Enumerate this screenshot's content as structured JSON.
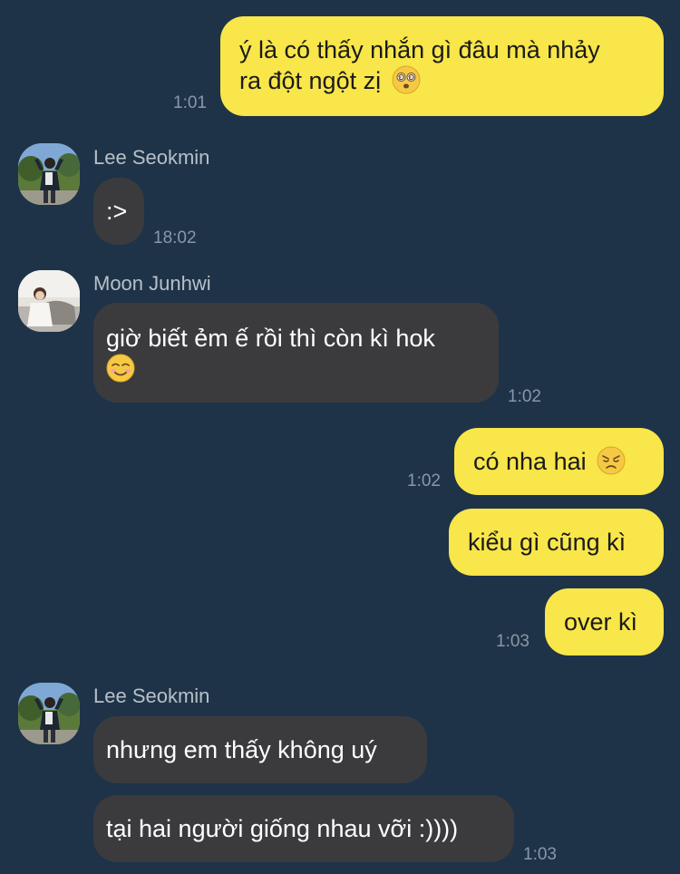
{
  "messages": {
    "m1": {
      "lines": [
        "ý là có thấy nhắn gì đâu mà nhảy",
        "ra đột ngột zị"
      ],
      "emoji": "dizzy-face-emoji",
      "time": "1:01"
    },
    "m2": {
      "sender": "Lee Seokmin",
      "text": ":>",
      "time": "18:02"
    },
    "m3": {
      "sender": "Moon Junhwi",
      "line1": "giờ biết ẻm ế rồi thì còn kì hok",
      "emoji": "smiling-face-emoji",
      "time": "1:02"
    },
    "m4": {
      "text": "có nha hai",
      "emoji": "disappointed-face-emoji",
      "time": "1:02"
    },
    "m5": {
      "text": "kiểu gì cũng kì"
    },
    "m6": {
      "text": "over kì",
      "time": "1:03"
    },
    "m7": {
      "sender": "Lee Seokmin",
      "text": "nhưng em thấy không uý"
    },
    "m8": {
      "text": "tại hai người giống nhau vỡi :))))",
      "time": "1:03"
    }
  },
  "colors": {
    "background": "#1e3348",
    "outgoing_bubble": "#f8e64a",
    "incoming_bubble": "#3b3b3d"
  }
}
